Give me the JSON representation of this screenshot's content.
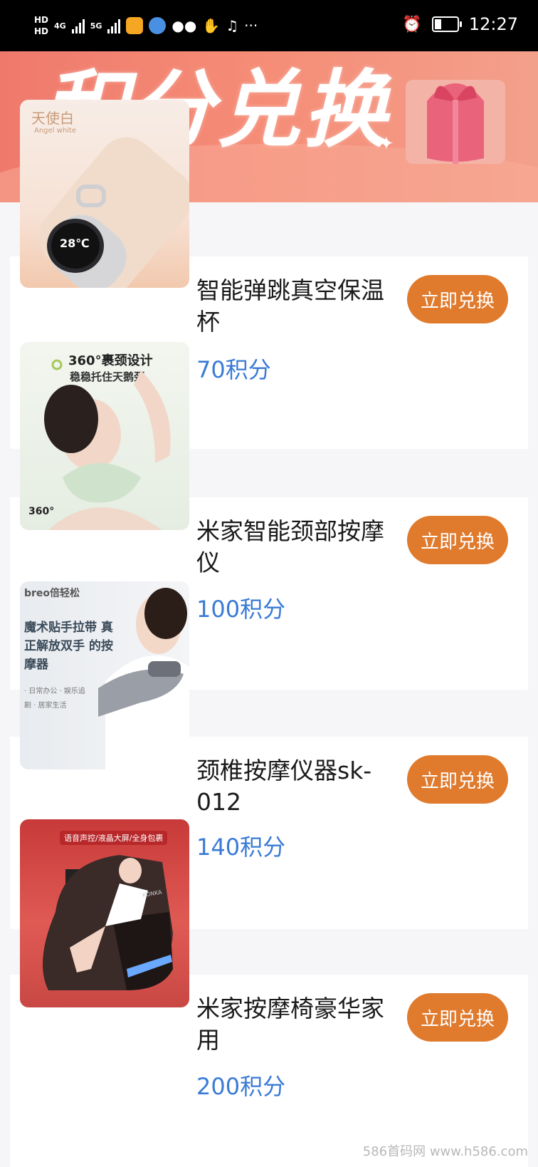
{
  "status_bar": {
    "hd1": "HD",
    "hd2": "HD",
    "net1": "4G",
    "net2": "5G",
    "more": "···",
    "time": "12:27"
  },
  "banner": {
    "title": "积分兑换"
  },
  "products": [
    {
      "thumb_label": "天使白",
      "thumb_sub": "Angel white",
      "thumb_extra": "28℃",
      "name": "智能弹跳真空保温杯",
      "points": "70积分",
      "button": "立即兑换"
    },
    {
      "thumb_label": "360°裹颈设计",
      "thumb_sub": "稳稳托住天鹅颈",
      "thumb_extra": "360°",
      "name": "米家智能颈部按摩仪",
      "points": "100积分",
      "button": "立即兑换"
    },
    {
      "thumb_label": "魔术贴手拉带 真正解放双手 的按摩器",
      "thumb_sub": "breo倍轻松",
      "thumb_extra": "· 日常办公 · 娱乐追剧 · 居家生活",
      "name": "颈椎按摩仪器sk-012",
      "points": "140积分",
      "button": "立即兑换"
    },
    {
      "thumb_label": "语音声控/液晶大屏/全身包裹",
      "thumb_sub": "KONKA",
      "thumb_extra": "",
      "name": "米家按摩椅豪华家用",
      "points": "200积分",
      "button": "立即兑换"
    }
  ],
  "watermark": "586首码网 www.h586.com"
}
